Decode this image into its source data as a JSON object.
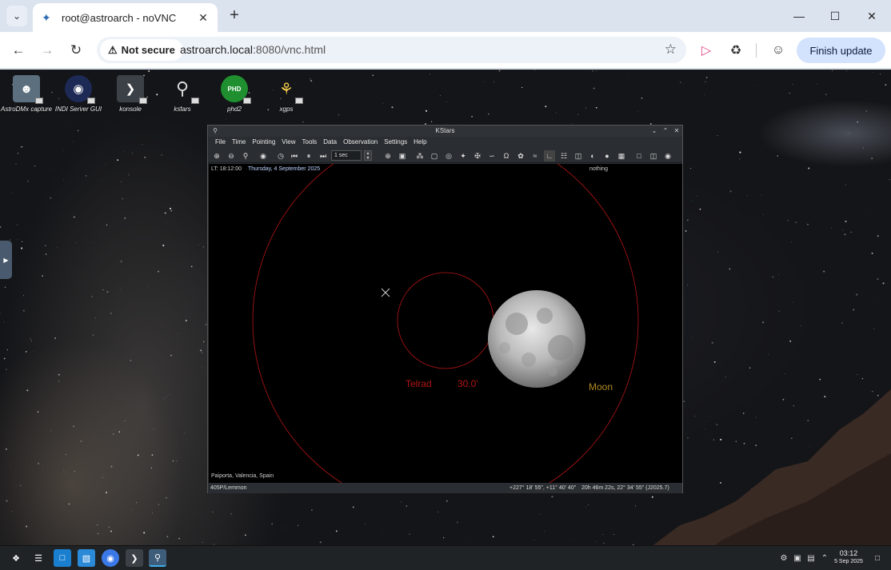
{
  "browser": {
    "tab_title": "root@astroarch - noVNC",
    "security_label": "Not secure",
    "url_host": "astroarch.local",
    "url_rest": ":8080/vnc.html",
    "finish_update_label": "Finish update",
    "colors": {
      "accent": "#d3e3fd",
      "tabstrip": "#dbe3ef"
    }
  },
  "desktop": {
    "icons": [
      {
        "label": "AstroDMx capture",
        "icon": "astrodmx-icon"
      },
      {
        "label": "INDI Server GUI",
        "icon": "indi-icon"
      },
      {
        "label": "konsole",
        "icon": "konsole-icon"
      },
      {
        "label": "kstars",
        "icon": "kstars-icon"
      },
      {
        "label": "phd2",
        "icon": "phd2-icon"
      },
      {
        "label": "xgps",
        "icon": "xgps-icon"
      }
    ]
  },
  "kstars": {
    "title": "KStars",
    "menu": [
      "File",
      "Time",
      "Pointing",
      "View",
      "Tools",
      "Data",
      "Observation",
      "Settings",
      "Help"
    ],
    "time_step": "1 sec",
    "local_time": "LT: 18:12:00",
    "date": "Thursday, 4 September 2025",
    "focus_object": "nothing",
    "location": "Paiporta, Valencia, Spain",
    "telrad_label": "Telrad",
    "telrad_size": "30.0'",
    "moon_label": "Moon",
    "status_left": "405P/Lemmon",
    "status_coords": "+227° 18' 55\", +11° 40' 40\"",
    "status_radec": "20h 46m 22s, 22° 34' 55\" (J2025.7)",
    "colors": {
      "telrad": "#b51515",
      "moon_label": "#b08a1e"
    }
  },
  "taskbar": {
    "time": "03:12",
    "date": "5 Sep 2025"
  }
}
